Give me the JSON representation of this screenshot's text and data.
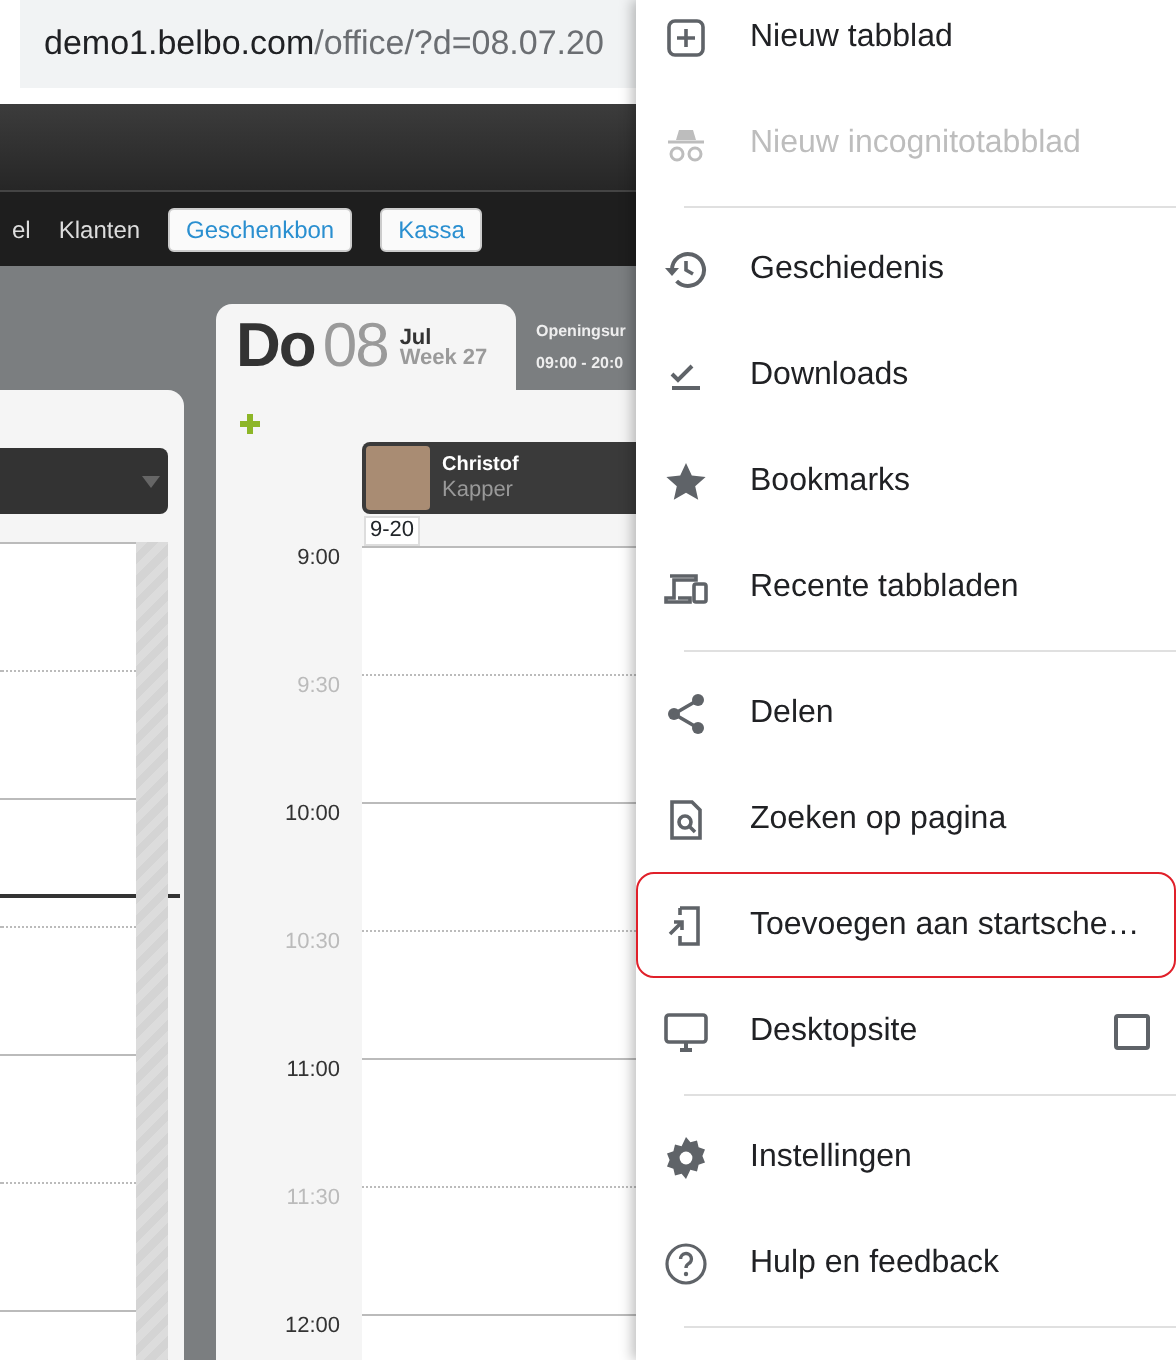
{
  "address_bar": {
    "host": "demo1.belbo.com",
    "path": "/office/?d=08.07.20"
  },
  "nav": {
    "links": [
      "el",
      "Klanten"
    ],
    "buttons": [
      "Geschenkbon",
      "Kassa"
    ]
  },
  "day": {
    "weekday": "Do",
    "day": "08",
    "month": "Jul",
    "week": "Week 27",
    "opening_title": "Openingsur",
    "opening_hours": "09:00 - 20:0"
  },
  "staff": {
    "name": "Christof",
    "role": "Kapper",
    "hours": "9-20"
  },
  "times": [
    {
      "label": "9:00",
      "kind": "hour"
    },
    {
      "label": "9:30",
      "kind": "half"
    },
    {
      "label": "10:00",
      "kind": "hour"
    },
    {
      "label": "10:30",
      "kind": "half"
    },
    {
      "label": "11:00",
      "kind": "hour"
    },
    {
      "label": "11:30",
      "kind": "half"
    },
    {
      "label": "12:00",
      "kind": "hour"
    }
  ],
  "menu": {
    "groups": [
      {
        "items": [
          {
            "label": "Nieuw tabblad",
            "kind": "action",
            "disabled": false,
            "highlighted": false
          },
          {
            "label": "Nieuw incognitotabblad",
            "kind": "action",
            "disabled": true,
            "highlighted": false
          }
        ]
      },
      {
        "items": [
          {
            "label": "Geschiedenis",
            "kind": "action",
            "disabled": false,
            "highlighted": false
          },
          {
            "label": "Downloads",
            "kind": "action",
            "disabled": false,
            "highlighted": false
          },
          {
            "label": "Bookmarks",
            "kind": "action",
            "disabled": false,
            "highlighted": false
          },
          {
            "label": "Recente tabbladen",
            "kind": "action",
            "disabled": false,
            "highlighted": false
          }
        ]
      },
      {
        "items": [
          {
            "label": "Delen",
            "kind": "action",
            "disabled": false,
            "highlighted": false
          },
          {
            "label": "Zoeken op pagina",
            "kind": "action",
            "disabled": false,
            "highlighted": false
          },
          {
            "label": "Toevoegen aan startsche…",
            "kind": "action",
            "disabled": false,
            "highlighted": true
          },
          {
            "label": "Desktopsite",
            "kind": "checkbox",
            "checked": false,
            "disabled": false,
            "highlighted": false
          }
        ]
      },
      {
        "items": [
          {
            "label": "Instellingen",
            "kind": "action",
            "disabled": false,
            "highlighted": false
          },
          {
            "label": "Hulp en feedback",
            "kind": "action",
            "disabled": false,
            "highlighted": false
          }
        ]
      }
    ]
  }
}
